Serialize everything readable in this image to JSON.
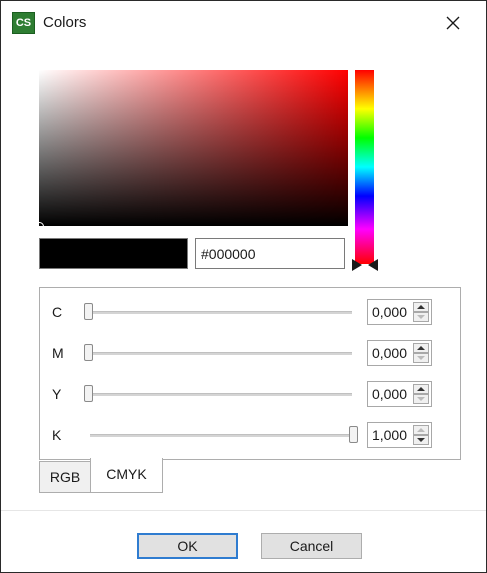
{
  "window": {
    "title": "Colors",
    "app_logo_text": "CS",
    "app_logo_color": "#2e7d32",
    "close_icon": "close-icon"
  },
  "picker": {
    "hue_color": "#ff0000",
    "selected_color": "#000000",
    "hex_value": "#000000"
  },
  "cmyk": {
    "rows": [
      {
        "label": "C",
        "value": "0,000",
        "level": 0.0
      },
      {
        "label": "M",
        "value": "0,000",
        "level": 0.0
      },
      {
        "label": "Y",
        "value": "0,000",
        "level": 0.0
      },
      {
        "label": "K",
        "value": "1,000",
        "level": 1.0
      }
    ]
  },
  "tabs": [
    {
      "label": "RGB",
      "active": false
    },
    {
      "label": "CMYK",
      "active": true
    }
  ],
  "buttons": {
    "ok_label": "OK",
    "cancel_label": "Cancel"
  }
}
